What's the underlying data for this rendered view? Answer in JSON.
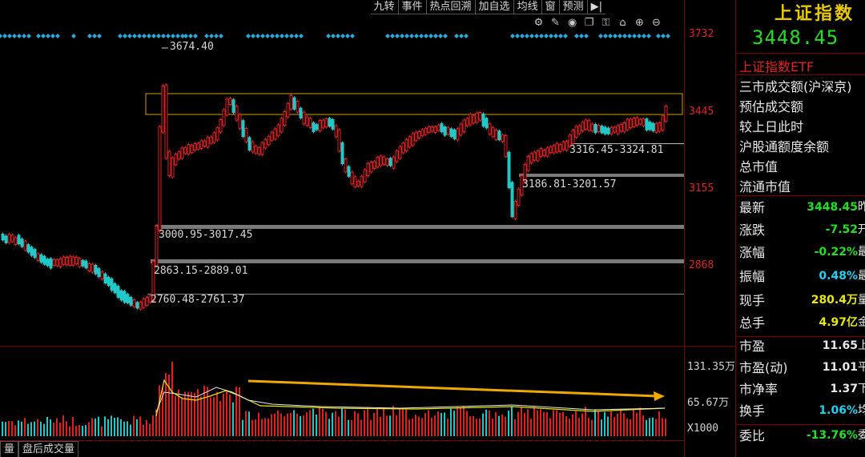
{
  "toolbar": [
    "九转",
    "事件",
    "热点回溯",
    "加自选",
    "均线",
    "窗",
    "预测",
    "▶|"
  ],
  "icons": [
    "settings-icon",
    "pen-icon",
    "eye-icon",
    "copy-icon",
    "lock-icon",
    "home-icon",
    "zoom-in-icon",
    "zoom-out-icon"
  ],
  "price_axis": {
    "p1": "3732",
    "p2": "3445",
    "p3": "3155",
    "p4": "2868"
  },
  "volume_axis": {
    "v1": "131.35万",
    "v2": "65.67万",
    "v3": "X1000"
  },
  "annotations": {
    "peak": "3674.40",
    "gap1": "3316.45-3324.81",
    "gap2": "3186.81-3201.57",
    "gap3": "3000.95-3017.45",
    "gap4": "2863.15-2889.01",
    "gap5": "2760.48-2761.37"
  },
  "tabs": [
    "量",
    "盘后成交量"
  ],
  "colors": {
    "up": "#e02020",
    "down": "#20c8c8",
    "accent": "#e8c800",
    "arrow": "#f0a800"
  },
  "side": {
    "title": "上证指数",
    "price": "3448.45",
    "etf": "上证指数ETF",
    "links": [
      "三市成交额(沪深京)",
      "预估成交额",
      "较上日此时",
      "沪股通额度余额",
      "总市值",
      "流通市值"
    ],
    "quotes": [
      {
        "label": "最新",
        "value": "3448.45",
        "tail": "昨",
        "color": "#20e020"
      },
      {
        "label": "涨跌",
        "value": "-7.52",
        "tail": "开",
        "color": "#20e020"
      },
      {
        "label": "涨幅",
        "value": "-0.22%",
        "tail": "最",
        "color": "#20e020"
      },
      {
        "label": "振幅",
        "value": "0.48%",
        "tail": "最",
        "color": "#20d0f0"
      },
      {
        "label": "现手",
        "value": "280.4万",
        "tail": "量",
        "color": "#e8e800"
      },
      {
        "label": "总手",
        "value": "4.97亿",
        "tail": "金",
        "color": "#e8e800"
      },
      {
        "label": "市盈",
        "value": "11.65",
        "tail": "上",
        "color": "#e8e8e8"
      },
      {
        "label": "市盈(动)",
        "value": "11.01",
        "tail": "平",
        "color": "#e8e8e8"
      },
      {
        "label": "市净率",
        "value": "1.37",
        "tail": "下",
        "color": "#e8e8e8"
      },
      {
        "label": "换手",
        "value": "1.06%",
        "tail": "均",
        "color": "#20d0f0"
      },
      {
        "label": "委比",
        "value": "-13.76%",
        "tail": "委",
        "color": "#20e020"
      }
    ]
  }
}
